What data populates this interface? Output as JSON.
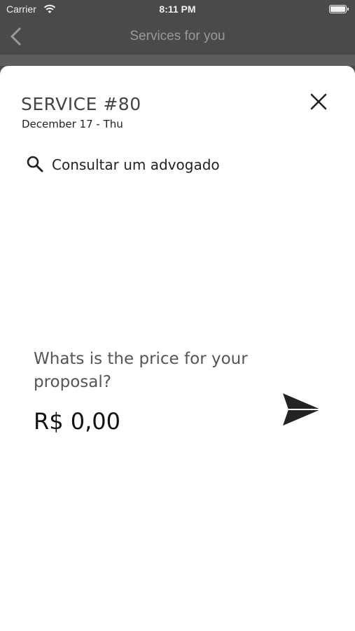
{
  "status_bar": {
    "carrier": "Carrier",
    "time": "8:11 PM"
  },
  "nav": {
    "title": "Services for you",
    "back_icon": "chevron-left-icon"
  },
  "modal": {
    "service_title": "SERVICE #80",
    "date": "December 17 - Thu",
    "close_icon": "close-icon",
    "search": {
      "icon": "search-icon",
      "text": "Consultar um advogado"
    },
    "question": "Whats is the price for your proposal?",
    "price_value": "R$ 0,00",
    "send_icon": "send-icon"
  },
  "colors": {
    "background_dim": "#4a4a4a",
    "sheet": "#ffffff",
    "text_primary": "#111111",
    "text_secondary": "#555555"
  }
}
